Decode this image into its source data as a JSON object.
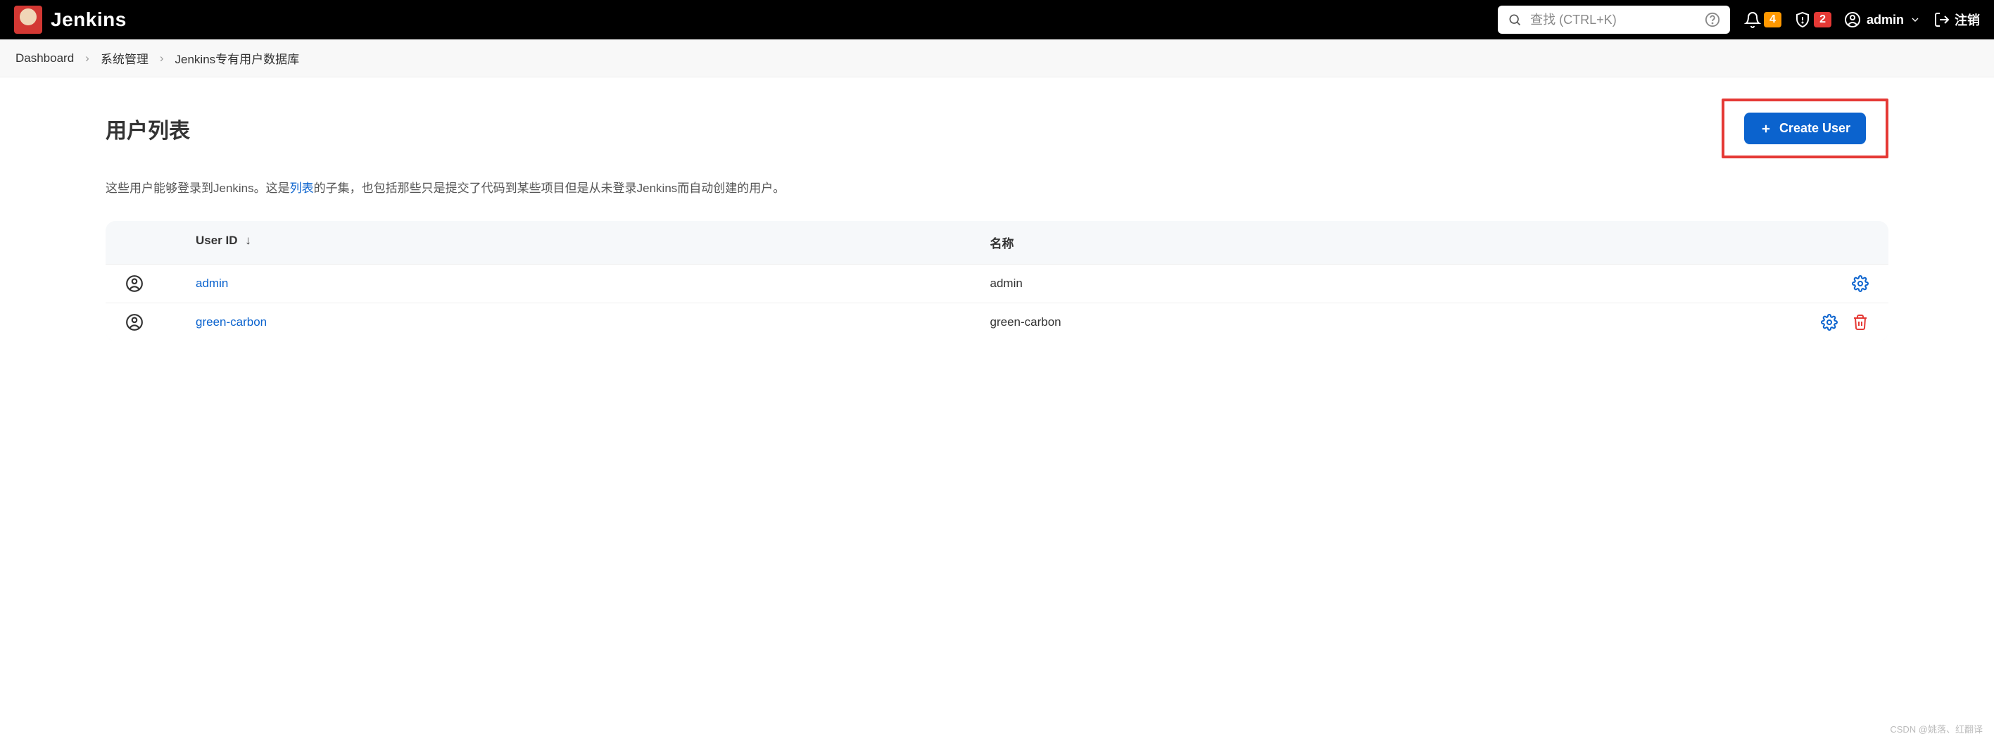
{
  "header": {
    "brand": "Jenkins",
    "search_placeholder": "查找 (CTRL+K)",
    "notif_count": "4",
    "alert_count": "2",
    "user": "admin",
    "logout": "注销"
  },
  "breadcrumbs": {
    "items": [
      "Dashboard",
      "系统管理",
      "Jenkins专有用户数据库"
    ]
  },
  "page": {
    "title": "用户列表",
    "create_button": "Create User",
    "desc_prefix": "这些用户能够登录到Jenkins。这是",
    "desc_link": "列表",
    "desc_suffix": "的子集，也包括那些只是提交了代码到某些项目但是从未登录Jenkins而自动创建的用户。"
  },
  "table": {
    "headers": {
      "userid": "User ID",
      "sort": "↓",
      "name": "名称"
    },
    "rows": [
      {
        "userid": "admin",
        "name": "admin",
        "deletable": false
      },
      {
        "userid": "green-carbon",
        "name": "green-carbon",
        "deletable": true
      }
    ]
  },
  "watermark": "CSDN @姚落、红翻译"
}
